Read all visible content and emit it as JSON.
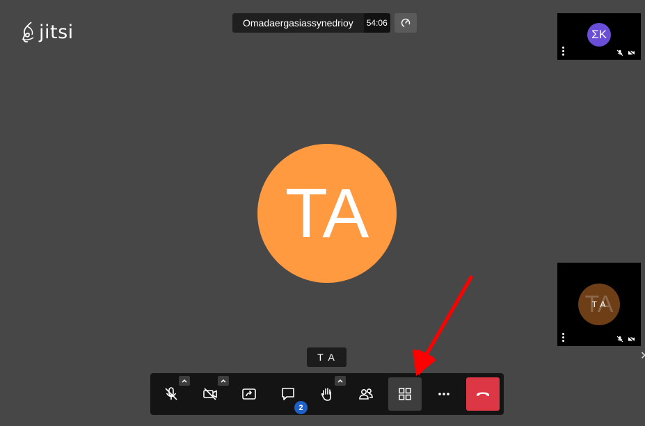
{
  "app": {
    "logo_text": "jitsi"
  },
  "header": {
    "meeting_name": "Omadaergasiassynedrioy",
    "timer": "54:06"
  },
  "main_participant": {
    "initials": "TA",
    "name_label": "T A",
    "color": "#ff9a40"
  },
  "thumbnails": [
    {
      "initials": "ΣK",
      "color": "#6b4ed8",
      "muted": true,
      "video_off": true
    },
    {
      "initials": "T A",
      "ghost_initials": "TA",
      "color": "#6e3e17",
      "muted": true,
      "video_off": true
    }
  ],
  "toolbar": {
    "buttons": [
      {
        "name": "microphone",
        "icon": "mic-off-icon"
      },
      {
        "name": "camera",
        "icon": "camera-off-icon"
      },
      {
        "name": "share-screen",
        "icon": "share-screen-icon"
      },
      {
        "name": "chat",
        "icon": "chat-icon",
        "badge": "2"
      },
      {
        "name": "raise-hand",
        "icon": "hand-icon"
      },
      {
        "name": "participants",
        "icon": "participants-icon"
      },
      {
        "name": "tile-view",
        "icon": "grid-icon",
        "active": true
      },
      {
        "name": "more-actions",
        "icon": "more-icon"
      },
      {
        "name": "hang-up",
        "icon": "hangup-icon",
        "color": "#dd3645"
      }
    ]
  },
  "annotation": {
    "arrow_color": "#ff0000"
  }
}
